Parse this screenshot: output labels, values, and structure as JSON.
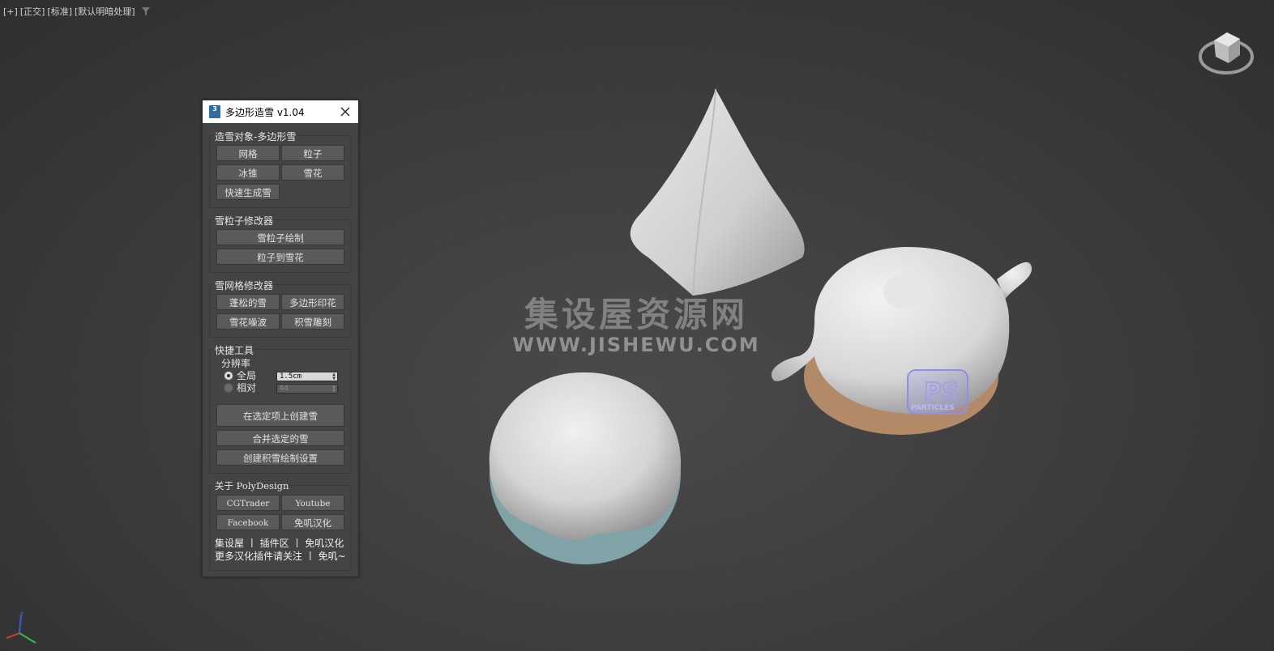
{
  "viewport": {
    "labels": [
      "[+]",
      "[正交]",
      "[标准]",
      "[默认明暗处理]"
    ]
  },
  "watermark": {
    "title": "集设屋资源网",
    "url": "WWW.JISHEWU.COM"
  },
  "logo": {
    "text": "PS",
    "subtext": "PARTICLES"
  },
  "panel": {
    "title": "多边形造雪 v1.04",
    "app_icon_text": "3",
    "groups": {
      "create": {
        "title": "造雪对象-多边形雪",
        "buttons": [
          "网格",
          "粒子",
          "冰锥",
          "雪花",
          "快速生成雪"
        ]
      },
      "particle_mod": {
        "title": "雪粒子修改器",
        "buttons": [
          "雪粒子绘制",
          "粒子到雪花"
        ]
      },
      "mesh_mod": {
        "title": "雪网格修改器",
        "buttons": [
          "蓬松的雪",
          "多边形印花",
          "雪花噪波",
          "积雪雕刻"
        ]
      },
      "tools": {
        "title": "快捷工具",
        "resolution_label": "分辨率",
        "radio_global": "全局",
        "radio_relative": "相对",
        "global_value": "1.5cm",
        "relative_value": "64",
        "buttons": [
          "在选定项上创建雪",
          "合并选定的雪",
          "创建积雪绘制设置"
        ]
      },
      "about": {
        "title": "关于 PolyDesign",
        "buttons": [
          "CGTrader",
          "Youtube",
          "Facebook",
          "免叽汉化"
        ],
        "footer1": "集设屋 丨 插件区 丨 免叽汉化",
        "footer2": "更多汉化插件请关注 丨 免叽~"
      }
    }
  },
  "colors": {
    "background": "#3e3e3e",
    "panel": "#444444",
    "button": "#5a5a5a",
    "snow": "#e2e2e2"
  }
}
